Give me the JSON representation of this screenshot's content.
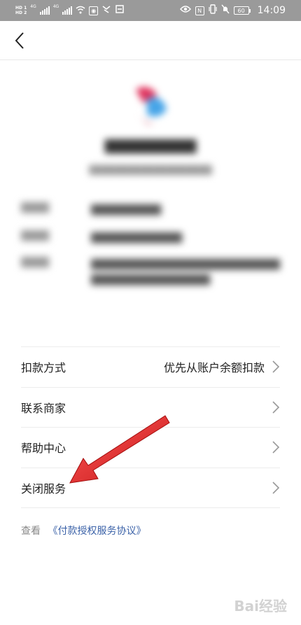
{
  "status_bar": {
    "carrier1": "HD 1",
    "carrier2": "HD 2",
    "net1": "4G",
    "net2": "4G",
    "battery": "60",
    "time": "14:09"
  },
  "nav": {
    "back_icon": "chevron-left-icon"
  },
  "header": {
    "merchant_name": "██████████",
    "merchant_sub": "███████████████████"
  },
  "info": [
    {
      "key": "████",
      "value": "██████████"
    },
    {
      "key": "████",
      "value": "█████████████"
    },
    {
      "key": "████",
      "value": "████████████████████████████████████████████"
    }
  ],
  "list": [
    {
      "label": "扣款方式",
      "value": "优先从账户余额扣款"
    },
    {
      "label": "联系商家",
      "value": ""
    },
    {
      "label": "帮助中心",
      "value": ""
    },
    {
      "label": "关闭服务",
      "value": ""
    }
  ],
  "agreement": {
    "prefix": "查看",
    "link": "《付款授权服务协议》"
  },
  "annotation": {
    "arrow_color": "#e52b2b"
  },
  "watermark": "Bai经验"
}
